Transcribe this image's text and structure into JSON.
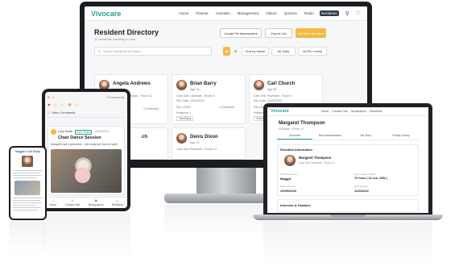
{
  "brand": "Vivocare",
  "colors": {
    "brand": "#2a9d8f",
    "accent": "#f5b942",
    "nav_active": "#2b3a4a"
  },
  "monitor": {
    "nav": [
      "Home",
      "Planner",
      "Activities",
      "Management",
      "Videos",
      "Quizzes",
      "Radio",
      "Residents"
    ],
    "nav_icons": [
      "search-icon",
      "bell-icon"
    ],
    "title": "Resident Directory",
    "subtitle": "17 residents currently in care",
    "create_btn": "Create Pic Assessment",
    "export_btn": "Export List",
    "add_btn": "Add New Resident",
    "search_placeholder": "Search residents by name...",
    "sort": "Sort by Name",
    "filter_units": "All Units",
    "filter_levels": "All Pic Levels",
    "cards": [
      {
        "name": "Angela Andrews",
        "age": "Age 85",
        "room": "Care Unit: Parkside - Room 12",
        "pic": "1 (Parental)",
        "extra": ""
      },
      {
        "name": "Brian Barry",
        "age": "Age 78",
        "room": "Care Unit: Lakeside - Room 8",
        "pic": "1 (Parental)",
        "date": "PAL Date: 10/10/2023",
        "level": "PAL LEVEL",
        "rel_label": "Relatives: 1",
        "rel": "Tom Barry"
      },
      {
        "name": "Carl Church",
        "age": "Age 90",
        "room": "Care Unit: Riverside - Room 7",
        "pic": "2 (Parental)",
        "date": "PAL Date: 10/10/2023",
        "level": "PAL LEVEL",
        "rel_label": "Relatives: 1",
        "rel": "Christine"
      },
      {
        "name": "Denis Dixon",
        "age": "Age 73",
        "room": "Care Unit: Riverside - Room 14"
      }
    ],
    "partial_name": "ch"
  },
  "laptop": {
    "nav": [
      "Home",
      "Contact Hub",
      "Newspapers",
      "Residents"
    ],
    "name": "Margaret Thompson",
    "sub": "Riverside - Room 12",
    "tabs": [
      "Overview",
      "Recommendations",
      "Life Story",
      "Family Library"
    ],
    "section": "Resident Information",
    "rname": "Margaret Thompson",
    "runit": "Care Unit: Riverside - Room 12",
    "known_as_label": "Preferred Name",
    "known_as": "Maggie",
    "age_label": "Age at Date of Birth",
    "age": "75 Years | 14 Jun, 1952 |",
    "admitted_label": "Date Admitted",
    "admitted": "20/09/2020",
    "review_label": "Next Review",
    "review": "12/3/2022",
    "section2": "Interests & Hobbies"
  },
  "tablet": {
    "comment_btn": "View Comments",
    "count": "3 Comments",
    "poster": "Lucy Smith",
    "tag": "Care Team",
    "date": "14/10/2023",
    "post_title": "Chair Dance Session",
    "post_body": "Margaret had a great time - she really got into the spirit!",
    "nav": [
      "Home",
      "Contact Hub",
      "Newspapers",
      "Relatives"
    ]
  },
  "phone": {
    "title": "Maggie's Life Story"
  }
}
